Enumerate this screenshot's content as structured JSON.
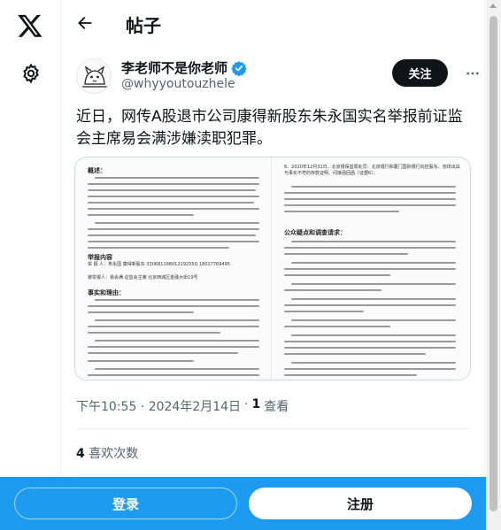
{
  "nav": {
    "logo_icon": "x-logo-icon",
    "settings_icon": "gear-icon"
  },
  "header": {
    "back_icon": "arrow-left-icon",
    "title": "帖子"
  },
  "author": {
    "name": "李老师不是你老师",
    "handle": "@whyyoutouzhele",
    "verified_color": "#1d9bf0",
    "follow_label": "关注",
    "more_icon": "more-horizontal-icon"
  },
  "post": {
    "text": "近日，网传A股退市公司康得新股东朱永国实名举报前证监会主席易会满涉嫌渎职犯罪。",
    "media": {
      "left_heading": "概述：",
      "left_section_1": "举报内容",
      "left_section_2": "事实和理由：",
      "left_reporter": "举 报 人：朱永国 康得新股东 33068119801219255O 18017769495",
      "left_reported": "被举报人：易会满 证监会主席 北京西城区金融大街19号",
      "right_heading": "公众疑点和调查请求：",
      "right_note": "6、2020年12月31日，北京银保监局处罚：北京银行和厦门国际银行向控股东、违规出具与事实不符的存款证明、间接函回函（证据6）。"
    },
    "time": "下午10:55 · 2024年2月14日",
    "views_count": "1",
    "views_label": "查看",
    "likes_count": "4",
    "likes_label": "喜欢次数"
  },
  "bottom_bar": {
    "login_label": "登录",
    "signup_label": "注册",
    "accent_color": "#1d9bf0"
  }
}
